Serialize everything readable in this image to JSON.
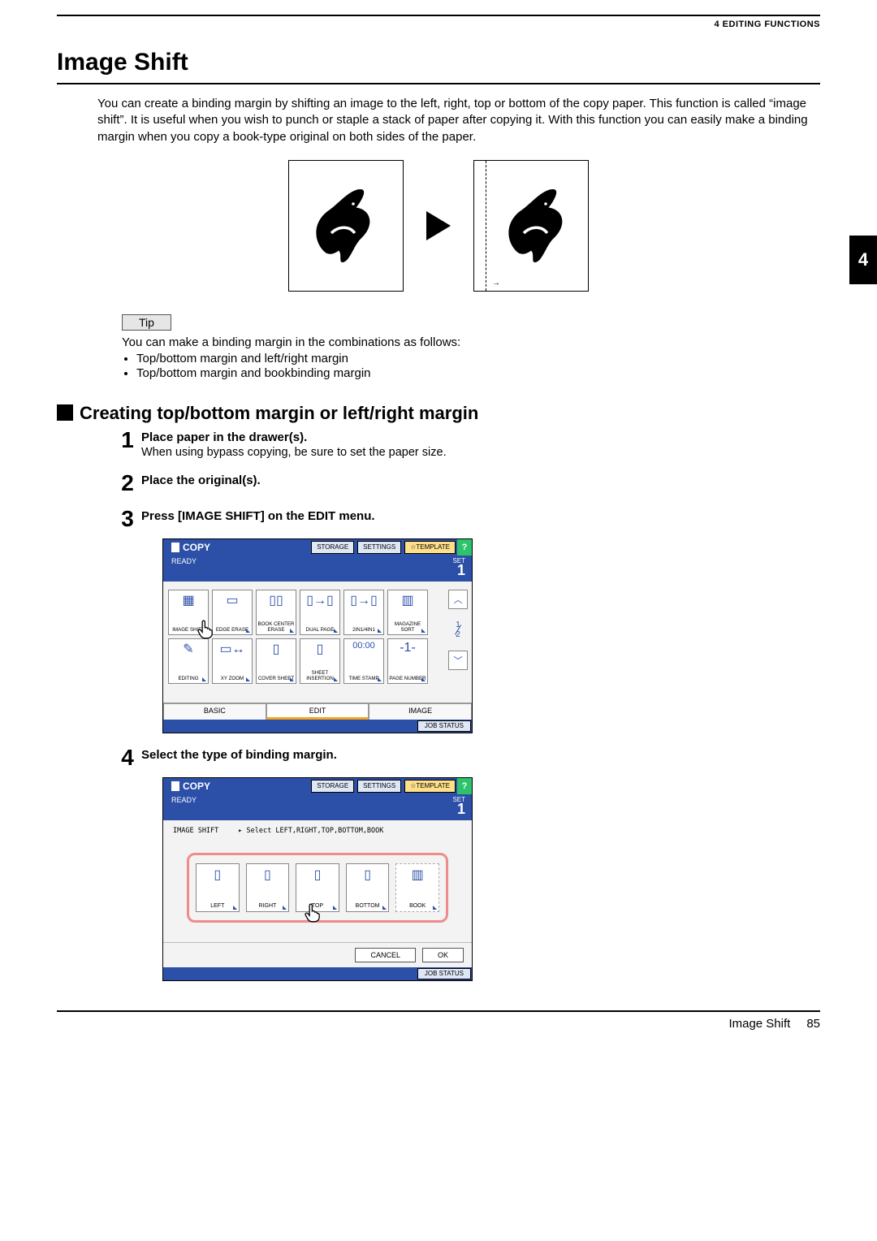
{
  "header": {
    "category": "4 EDITING FUNCTIONS"
  },
  "chapter_tab": "4",
  "section_title": "Image Shift",
  "intro": "You can create a binding margin by shifting an image to the left, right, top or bottom of the copy paper. This function is called “image shift”. It is useful when you wish to punch or staple a stack of paper after copying it. With this function you can easily make a binding margin when you copy a book-type original on both sides of the paper.",
  "tip": {
    "label": "Tip",
    "text": "You can make a binding margin in the combinations as follows:",
    "items": [
      "Top/bottom margin and left/right margin",
      "Top/bottom margin and bookbinding margin"
    ]
  },
  "sub_title": "Creating top/bottom margin or left/right margin",
  "steps": [
    {
      "n": "1",
      "head": "Place paper in the drawer(s).",
      "sub": "When using bypass copying, be sure to set the paper size."
    },
    {
      "n": "2",
      "head": "Place the original(s)."
    },
    {
      "n": "3",
      "head": "Press [IMAGE SHIFT] on the EDIT menu."
    },
    {
      "n": "4",
      "head": "Select the type of binding margin."
    }
  ],
  "panel": {
    "copy": "COPY",
    "storage": "STORAGE",
    "settings": "SETTINGS",
    "template": "TEMPLATE",
    "help": "?",
    "ready": "READY",
    "set": "SET",
    "count": "1",
    "tabs": {
      "basic": "BASIC",
      "edit": "EDIT",
      "image": "IMAGE"
    },
    "job_status": "JOB STATUS",
    "grid": [
      "IMAGE SHIFT",
      "EDGE ERASE",
      "BOOK CENTER ERASE",
      "DUAL PAGE",
      "2IN1/4IN1",
      "MAGAZINE SORT",
      "EDITING",
      "XY ZOOM",
      "COVER SHEET",
      "SHEET INSERTION",
      "TIME STAMP",
      "PAGE NUMBER"
    ],
    "time": "00:00",
    "page_of": {
      "cur": "1",
      "tot": "2"
    }
  },
  "panel2": {
    "title": "IMAGE SHIFT",
    "hint": "▸ Select LEFT,RIGHT,TOP,BOTTOM,BOOK",
    "options": [
      "LEFT",
      "RIGHT",
      "TOP",
      "BOTTOM",
      "BOOK"
    ],
    "cancel": "CANCEL",
    "ok": "OK"
  },
  "footer": {
    "label": "Image Shift",
    "page": "85"
  }
}
